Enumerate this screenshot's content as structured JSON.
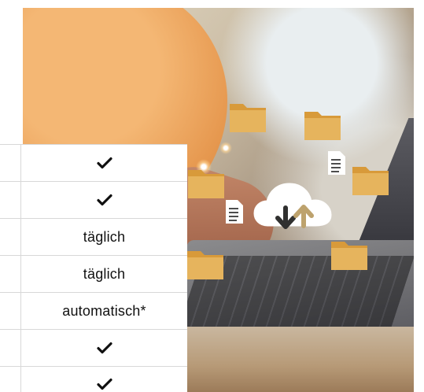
{
  "table": {
    "rows": [
      {
        "kind": "check",
        "icon": "checkmark-icon"
      },
      {
        "kind": "check",
        "icon": "checkmark-icon"
      },
      {
        "kind": "text",
        "label": "täglich"
      },
      {
        "kind": "text",
        "label": "täglich"
      },
      {
        "kind": "text",
        "label": "automatisch*"
      },
      {
        "kind": "check",
        "icon": "checkmark-icon"
      },
      {
        "kind": "check",
        "icon": "checkmark-icon"
      }
    ]
  },
  "colors": {
    "shirt": "#e6984f",
    "folder": "#d89a3a",
    "cloud": "#ffffff",
    "table_border": "#d8d8d8"
  },
  "photo": {
    "icons": [
      "cloud-upload-download-icon",
      "folder-icon",
      "document-icon"
    ]
  }
}
